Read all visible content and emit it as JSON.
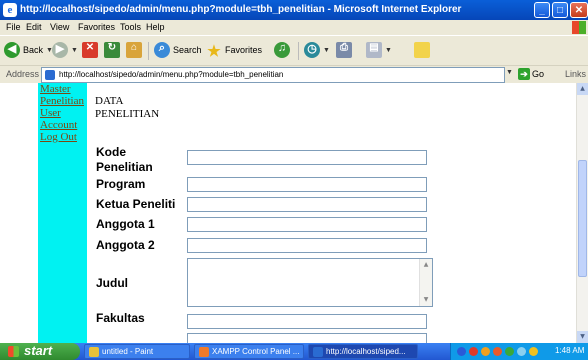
{
  "window": {
    "title": "http://localhost/sipedo/admin/menu.php?module=tbh_penelitian - Microsoft Internet Explorer",
    "min_glyph": "_",
    "max_glyph": "□",
    "close_glyph": "✕"
  },
  "menubar": {
    "items": [
      "File",
      "Edit",
      "View",
      "Favorites",
      "Tools",
      "Help"
    ]
  },
  "toolbar": {
    "back_label": "Back",
    "search_label": "Search",
    "favorites_label": "Favorites"
  },
  "addressbar": {
    "label": "Address",
    "url": "http://localhost/sipedo/admin/menu.php?module=tbh_penelitian",
    "go_label": "Go",
    "links_label": "Links"
  },
  "sidebar": {
    "links": [
      "Master",
      "Penelitian",
      "User",
      "Account",
      "Log Out"
    ]
  },
  "content": {
    "title": "DATA PENELITIAN",
    "fields": [
      {
        "label": "Kode Penelitian",
        "value": ""
      },
      {
        "label": "Program",
        "value": ""
      },
      {
        "label": "Ketua Peneliti",
        "value": ""
      },
      {
        "label": "Anggota 1",
        "value": ""
      },
      {
        "label": "Anggota 2",
        "value": ""
      },
      {
        "label": "Judul",
        "value": ""
      },
      {
        "label": "Fakultas",
        "value": ""
      }
    ]
  },
  "taskbar": {
    "start_label": "start",
    "tasks": [
      {
        "label": "untitled - Paint",
        "icon_color": "#e8c13a"
      },
      {
        "label": "XAMPP Control Panel ...",
        "icon_color": "#f07a2a"
      },
      {
        "label": "http://localhost/siped...",
        "icon_color": "#2a6bd1"
      }
    ],
    "clock": "1:48 AM"
  },
  "colors": {
    "sidebar_bg": "#00f2f2",
    "link": "#7a4a12",
    "titlebar": "#0a5fd8",
    "taskbar": "#2f66dc"
  }
}
